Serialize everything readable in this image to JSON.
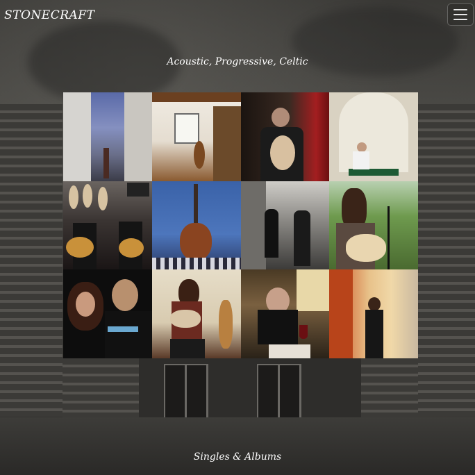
{
  "nav": {
    "brand": "STONECRAFT",
    "menu_icon": "hamburger-icon"
  },
  "hero": {
    "tagline": "Acoustic, Progressive, Celtic"
  },
  "gallery": {
    "photos": [
      {
        "subject": "narrow-street-at-dusk"
      },
      {
        "subject": "interior-with-mandolin"
      },
      {
        "subject": "guitarist-performing-red-light"
      },
      {
        "subject": "man-seated-in-archway"
      },
      {
        "subject": "duo-with-guitars-in-shop"
      },
      {
        "subject": "guitar-against-blue-wall"
      },
      {
        "subject": "duo-in-stone-alley"
      },
      {
        "subject": "singer-with-guitar-outdoors"
      },
      {
        "subject": "duo-portrait-dark"
      },
      {
        "subject": "woman-with-guitar-chair"
      },
      {
        "subject": "man-at-cafe-table"
      },
      {
        "subject": "woman-in-sunny-street"
      }
    ]
  },
  "sections": {
    "singles_title": "Singles & Albums"
  }
}
